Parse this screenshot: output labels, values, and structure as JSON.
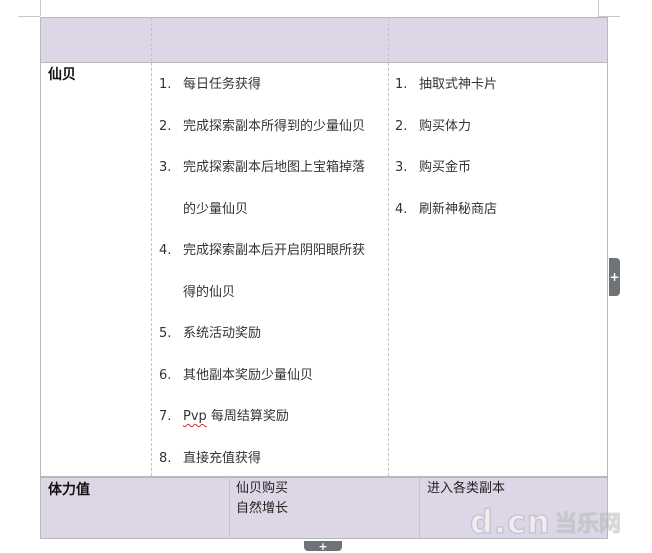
{
  "table": {
    "row1": {
      "label": "仙贝",
      "sources": [
        {
          "num": "1.",
          "lines": [
            "每日任务获得"
          ]
        },
        {
          "num": "2.",
          "lines": [
            "完成探索副本所得到的少量仙贝"
          ]
        },
        {
          "num": "3.",
          "lines": [
            "完成探索副本后地图上宝箱掉落",
            "的少量仙贝"
          ]
        },
        {
          "num": "4.",
          "lines": [
            "完成探索副本后开启阴阳眼所获",
            "得的仙贝"
          ]
        },
        {
          "num": "5.",
          "lines": [
            "系统活动奖励"
          ]
        },
        {
          "num": "6.",
          "lines": [
            "其他副本奖励少量仙贝"
          ]
        },
        {
          "num": "7.",
          "pvp": "Pvp",
          "lines": [
            " 每周结算奖励"
          ]
        },
        {
          "num": "8.",
          "lines": [
            "直接充值获得"
          ]
        }
      ],
      "uses": [
        {
          "num": "1.",
          "text": "抽取式神卡片"
        },
        {
          "num": "2.",
          "text": "购买体力"
        },
        {
          "num": "3.",
          "text": "购买金币"
        },
        {
          "num": "4.",
          "text": "刷新神秘商店"
        }
      ]
    },
    "row2": {
      "label": "体力值",
      "sources": [
        "仙贝购买",
        "自然增长"
      ],
      "uses": "进入各类副本"
    }
  },
  "watermark": {
    "mark": "d.cn",
    "text": "当乐网"
  },
  "handles": {
    "add_symbol": "+"
  }
}
